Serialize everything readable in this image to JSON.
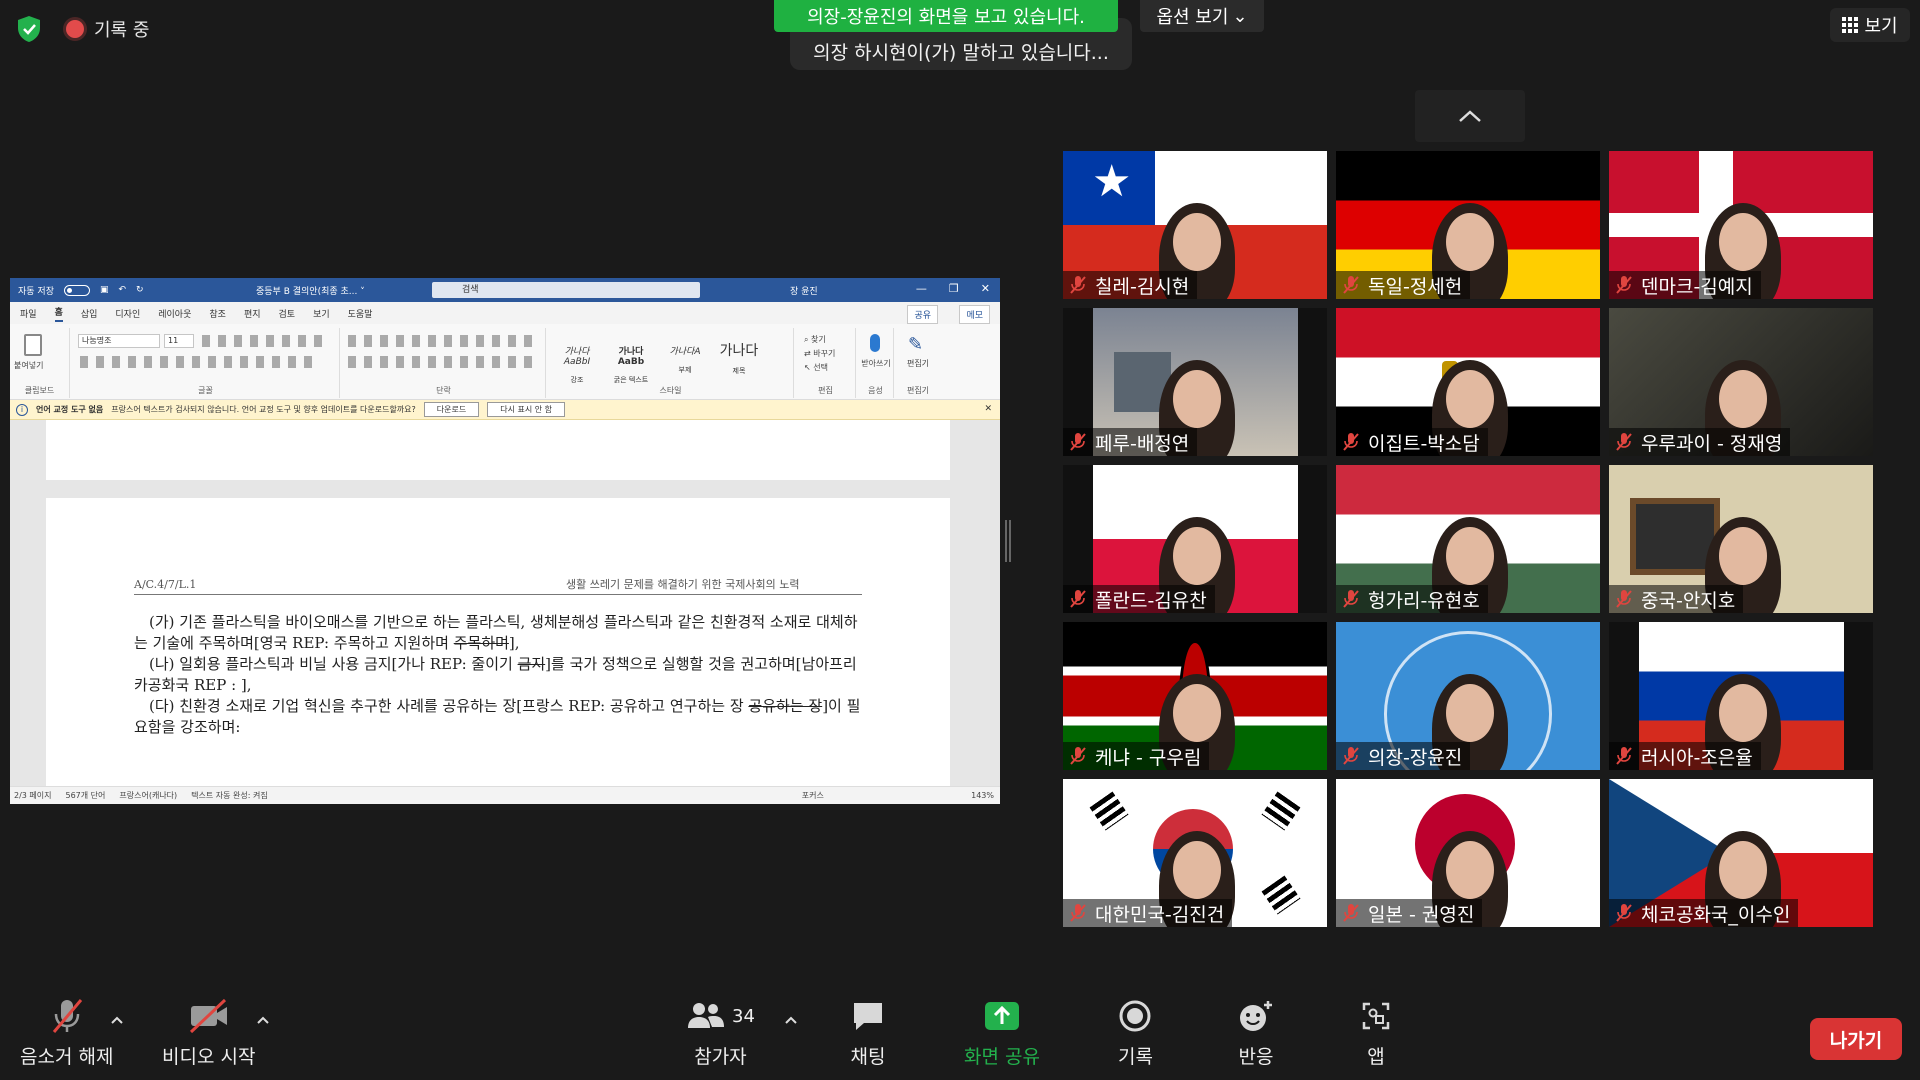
{
  "top": {
    "recording_label": "기록 중",
    "share_banner": "의장-장윤진의 화면을 보고 있습니다.",
    "view_options": "옵션 보기",
    "caption_text": "의장 하시현이(가) 말하고 있습니다...",
    "view_button": "보기"
  },
  "word": {
    "autosave": "자동 저장",
    "doc_title": "중등부 B 결의안(최종 초... ˅",
    "search_placeholder": "검색",
    "user": "장 윤진",
    "menu": [
      "파일",
      "홈",
      "삽입",
      "디자인",
      "레이아웃",
      "참조",
      "편지",
      "검토",
      "보기",
      "도움말"
    ],
    "share": "공유",
    "memo": "메모",
    "font_name": "나눔명조",
    "font_size": "11",
    "groups": [
      "클립보드",
      "글꼴",
      "단락",
      "스타일",
      "편집",
      "음성",
      "편집기"
    ],
    "paste": "붙여넣기",
    "styles": [
      {
        "sample": "가나다AaBbI",
        "name": "강조"
      },
      {
        "sample": "가나다AaBb",
        "name": "굵은 텍스트"
      },
      {
        "sample": "가나다A",
        "name": "부제"
      },
      {
        "sample": "가나다",
        "name": "제목"
      }
    ],
    "find": "찾기",
    "replace": "바꾸기",
    "select": "선택",
    "dictate": "받아쓰기",
    "editor": "편집기",
    "info_title": "언어 교정 도구 없음",
    "info_text": "프랑스어 텍스트가 검사되지 않습니다. 언어 교정 도구 및 향후 업데이트를 다운로드할까요?",
    "info_btn1": "다운로드",
    "info_btn2": "다시 표시 안 함",
    "header_left": "A/C.4/7/L.1",
    "header_right": "생활 쓰레기 문제를 해결하기 위한 국제사회의 노력",
    "para1_a": "(가) 기존 플라스틱을 바이오매스를 기반으로 하는 플라스틱, 생체분해성 플라스틱과 같은 친환경적 소재로 대체하는 기술에 주목하며[영국 REP: 주목하고 지원하며 ",
    "para1_strike": "주목하며",
    "para1_b": "],",
    "para2_a": "(나) 일회용 플라스틱과 비닐 사용 금지[가나 REP: 줄이기 ",
    "para2_strike": "금지",
    "para2_b": "]를 국가 정책으로 실행할 것을 권고하며[남아프리카공화국 REP : ],",
    "para3_a": "(다) 친환경 소재로 기업 혁신을 추구한 사례를 공유하는 장[프랑스 REP: 공유하고 연구하는 장 ",
    "para3_strike": "공유하는 장",
    "para3_b": "]이 필요함을 강조하며:",
    "status_page": "2/3 페이지",
    "status_words": "567개 단어",
    "status_lang": "프랑스어(캐나다)",
    "status_autocomplete": "텍스트 자동 완성: 켜짐",
    "status_focus": "포커스",
    "status_zoom": "143%"
  },
  "participants": [
    {
      "name": "칠레-김시현",
      "flag": "chile"
    },
    {
      "name": "독일-정세헌",
      "flag": "germany"
    },
    {
      "name": "덴마크-김예지",
      "flag": "denmark"
    },
    {
      "name": "페루-배정연",
      "flag": "room"
    },
    {
      "name": "이집트-박소담",
      "flag": "egypt"
    },
    {
      "name": "우루과이 - 정재영",
      "flag": "dark"
    },
    {
      "name": "폴란드-김유찬",
      "flag": "poland"
    },
    {
      "name": "헝가리-유현호",
      "flag": "hungary"
    },
    {
      "name": "중국-안지호",
      "flag": "wall"
    },
    {
      "name": "케냐 - 구우림",
      "flag": "kenya"
    },
    {
      "name": "의장-장윤진",
      "flag": "un"
    },
    {
      "name": "러시아-조은율",
      "flag": "russia"
    },
    {
      "name": "대한민국-김진건",
      "flag": "korea"
    },
    {
      "name": "일본 - 권영진",
      "flag": "japan"
    },
    {
      "name": "체코공화국_이수인",
      "flag": "czech"
    }
  ],
  "toolbar": {
    "unmute": "음소거 해제",
    "start_video": "비디오 시작",
    "participants": "참가자",
    "participant_count": "34",
    "chat": "채팅",
    "share_screen": "화면 공유",
    "record": "기록",
    "reactions": "반응",
    "apps": "앱",
    "leave": "나가기"
  },
  "colors": {
    "share_green": "#1fb141",
    "leave_red": "#d93434",
    "word_blue": "#2b579a"
  }
}
